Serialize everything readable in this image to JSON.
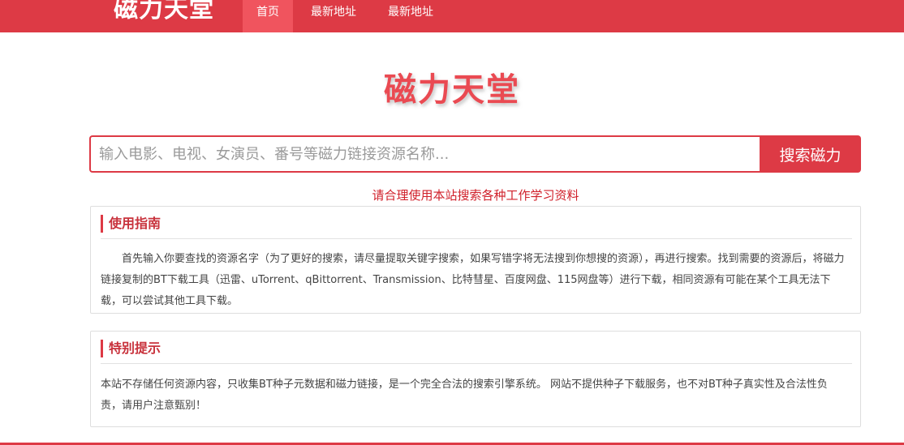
{
  "navbar": {
    "logo": "磁力天堂",
    "items": [
      {
        "label": "首页",
        "active": true
      },
      {
        "label": "最新地址",
        "active": false
      },
      {
        "label": "最新地址",
        "active": false
      }
    ]
  },
  "brand": {
    "title": "磁力天堂"
  },
  "search": {
    "placeholder": "输入电影、电视、女演员、番号等磁力链接资源名称...",
    "value": "",
    "button_label": "搜索磁力"
  },
  "notice": "请合理使用本站搜索各种工作学习资料",
  "guide": {
    "title": "使用指南",
    "body": "首先输入你要查找的资源名字（为了更好的搜索，请尽量提取关键字搜索，如果写错字将无法搜到你想搜的资源），再进行搜索。找到需要的资源后，将磁力链接复制的BT下载工具（迅雷、uTorrent、qBittorrent、Transmission、比特彗星、百度网盘、115网盘等）进行下载，相同资源有可能在某个工具无法下载，可以尝试其他工具下载。"
  },
  "tips": {
    "title": "特别提示",
    "body": "本站不存储任何资源内容，只收集BT种子元数据和磁力链接，是一个完全合法的搜索引擎系统。 网站不提供种子下载服务，也不对BT种子真实性及合法性负责，请用户注意甄别！"
  },
  "colors": {
    "accent": "#dd3a45",
    "notice": "#d0202a"
  }
}
